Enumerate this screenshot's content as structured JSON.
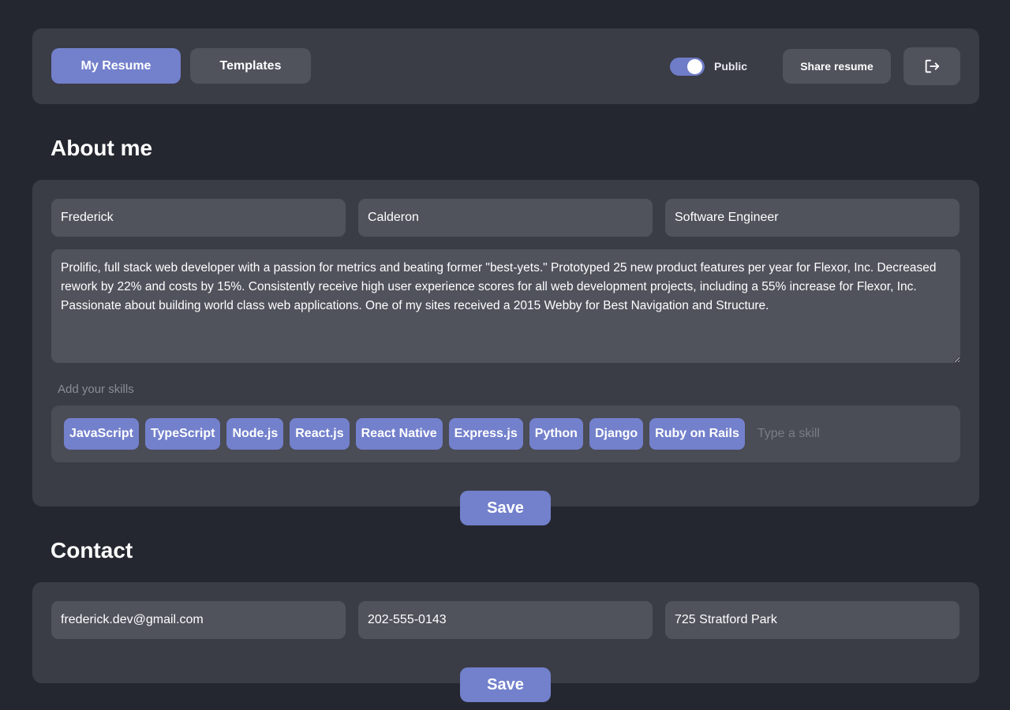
{
  "topbar": {
    "my_resume_label": "My Resume",
    "templates_label": "Templates",
    "public_toggle": {
      "label": "Public",
      "on": true
    },
    "share_label": "Share resume",
    "logout_icon": "logout-icon"
  },
  "about": {
    "title": "About me",
    "first_name": "Frederick",
    "last_name": "Calderon",
    "job_title": "Software Engineer",
    "bio": "Prolific, full stack web developer with a passion for metrics and beating former \"best-yets.\" Prototyped 25 new product features per year for Flexor, Inc. Decreased rework by 22% and costs by 15%. Consistently receive high user experience scores for all web development projects, including a 55% increase for Flexor, Inc. Passionate about building world class web applications. One of my sites received a 2015 Webby for Best Navigation and Structure.",
    "skills_label": "Add your skills",
    "skills": [
      "JavaScript",
      "TypeScript",
      "Node.js",
      "React.js",
      "React Native",
      "Express.js",
      "Python",
      "Django",
      "Ruby on Rails"
    ],
    "skill_placeholder": "Type a skill",
    "save_label": "Save"
  },
  "contact": {
    "title": "Contact",
    "email": "frederick.dev@gmail.com",
    "phone": "202-555-0143",
    "address": "725 Stratford Park",
    "save_label": "Save"
  },
  "colors": {
    "background": "#252730",
    "card": "#3a3c46",
    "field": "#50525c",
    "accent": "#7380cc"
  }
}
